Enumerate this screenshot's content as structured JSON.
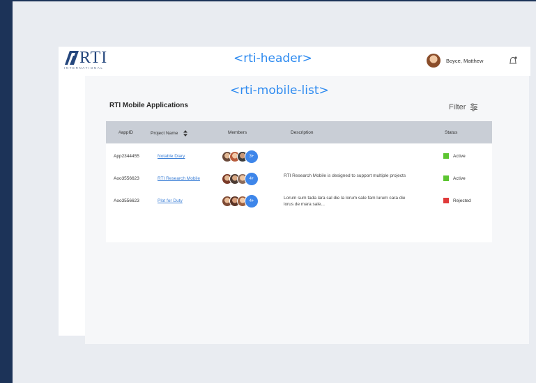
{
  "colors": {
    "active": "#5cc531",
    "rejected": "#e03a3a",
    "accent": "#2f8bf0",
    "link": "#3a7ed6"
  },
  "header": {
    "logo_text": "RTI",
    "logo_subtext": "INTERNATIONAL",
    "component_tag": "<rti-header>",
    "user_name": "Boyce, Matthew",
    "notification_icon": "bell-icon"
  },
  "main": {
    "component_tag": "<rti-mobile-list>",
    "title": "RTI Mobile Applications",
    "filter_label": "Filter",
    "filter_icon": "sliders-icon",
    "columns": [
      "#appID",
      "Project Name",
      "Members",
      "Description",
      "Status"
    ],
    "rows": [
      {
        "app_id": "App2344455",
        "project_name": "Notable Diary",
        "member_count": "3+",
        "description": "",
        "status": "Active"
      },
      {
        "app_id": "Aoo3556623",
        "project_name": "RTI Research Mobile",
        "member_count": "4+",
        "description": "RTI Research Mobile is designed to support multiple projects",
        "status": "Active"
      },
      {
        "app_id": "Aoo3556623",
        "project_name": "Plot for Duty",
        "member_count": "4+",
        "description": "Lorum sum tada lara sal die la lorum sale fam lurum cara die lorus de mara sale...",
        "status": "Rejected"
      }
    ]
  }
}
